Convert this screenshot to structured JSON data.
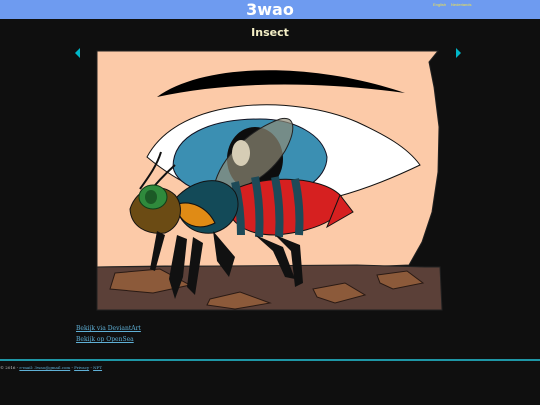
{
  "header": {
    "site_title": "3wao",
    "languages": [
      "English",
      "Nederlands"
    ],
    "background_color": "#6e9bf0",
    "language_color": "#f2e24a"
  },
  "artwork": {
    "title": "Insect",
    "prev_icon": "triangle-left-icon",
    "next_icon": "triangle-right-icon",
    "arrow_color": "#00b7c8",
    "subject": "insect-illustration"
  },
  "links": {
    "deviantart": "Bekijk via DeviantArt",
    "opensea": "Bekijk op OpenSea"
  },
  "footer": {
    "copyright": "© 2016 -",
    "email_label": "e-mail: 3wao@gmail.com",
    "separator": "-",
    "privacy": "Privacy",
    "nft": "NFT",
    "line_color": "#1e96a6"
  }
}
